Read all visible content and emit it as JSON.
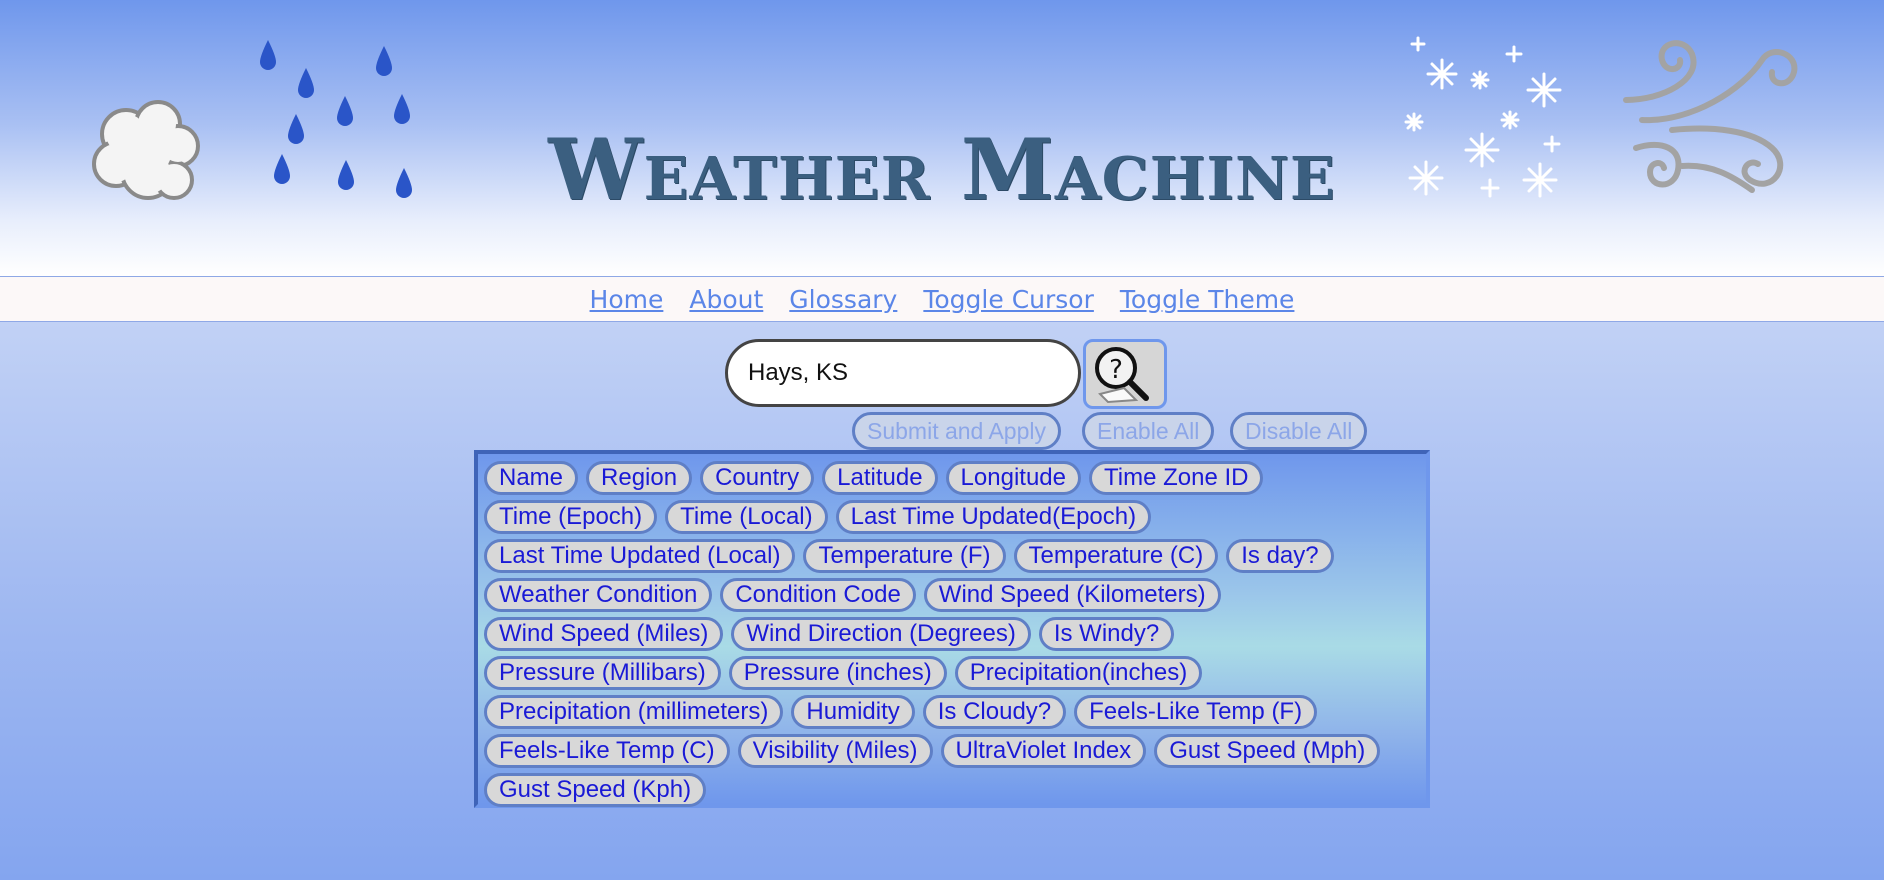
{
  "header": {
    "title": "Weather Machine"
  },
  "nav": {
    "links": [
      "Home",
      "About",
      "Glossary",
      "Toggle Cursor",
      "Toggle Theme"
    ]
  },
  "search": {
    "value": "Hays, KS"
  },
  "actions": {
    "submit_label": "Submit and Apply",
    "enable_label": "Enable All",
    "disable_label": "Disable All"
  },
  "fields": {
    "rows": [
      [
        "Name",
        "Region",
        "Country",
        "Latitude",
        "Longitude",
        "Time Zone ID"
      ],
      [
        "Time (Epoch)",
        "Time (Local)",
        "Last Time Updated(Epoch)"
      ],
      [
        "Last Time Updated (Local)",
        "Temperature (F)",
        "Temperature (C)",
        "Is day?"
      ],
      [
        "Weather Condition",
        "Condition Code",
        "Wind Speed (Kilometers)"
      ],
      [
        "Wind Speed (Miles)",
        "Wind Direction (Degrees)",
        "Is Windy?"
      ],
      [
        "Pressure (Millibars)",
        "Pressure (inches)",
        "Precipitation(inches)"
      ],
      [
        "Precipitation (millimeters)",
        "Humidity",
        "Is Cloudy?",
        "Feels-Like Temp (F)"
      ],
      [
        "Feels-Like Temp (C)",
        "Visibility (Miles)",
        "UltraViolet Index",
        "Gust Speed (Mph)"
      ],
      [
        "Gust Speed (Kph)"
      ]
    ]
  },
  "icons": {
    "cloud": "cloud-icon",
    "rain": "rain-drops-icon",
    "snow": "snowflakes-icon",
    "wind": "wind-swirl-icon",
    "search": "magnifier-question-icon"
  },
  "colors": {
    "title": "#3b5f80",
    "link": "#5b86e8",
    "chip_text": "#1a1ad6",
    "rain": "#2a55c8"
  }
}
